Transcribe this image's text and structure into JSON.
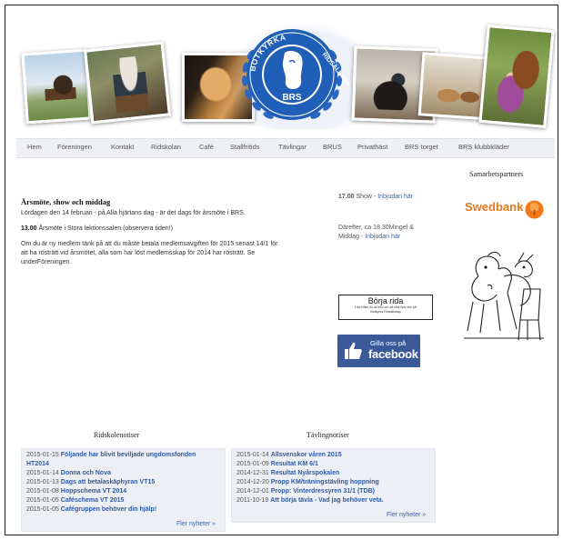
{
  "logo": {
    "ring_top": "BOTKYRKA",
    "ring_right": "RIDSÄLLSKAP",
    "center": "BRS"
  },
  "nav": [
    "Hem",
    "Föreningen",
    "Kontakt",
    "Ridskolan",
    "Café",
    "Stallfritids",
    "Tävlingar",
    "BRUS",
    "Privathäst",
    "BRS torget",
    "BRS klubbkläder"
  ],
  "article": {
    "title": "Årsmöte, show och middag",
    "line1": "Lördagen den 14 februari - på Alla hjärtans dag - är det dags för årsmöte i BRS.",
    "time1": "13.00",
    "line2": " Årsmöte i Stora lektionssalen (observera tiden!)",
    "p3_l1": "Om du är ny medlem tänk på att du måste betala medlemsavgiften för 2015 senast 14/1 för",
    "p3_l2": "att ha rösträtt vid årsmötet, alla som har löst medlemsskap för 2014 har rösträtt. Se",
    "p3_l3": "underFöreningen."
  },
  "side": {
    "time": "17.00",
    "show": " Show - ",
    "show_link": "Inbjudan här",
    "after_l1": "Därefter, ca 18.30Mingel &",
    "after_l2": "Middag - ",
    "after_link": "Inbjudan här"
  },
  "borja": {
    "title": "Börja rida",
    "sub1": "Här hittar du all info om att rida hos oss på",
    "sub2": "Botkyrka Ridsällskap"
  },
  "facebook": {
    "small": "Gilla oss på",
    "big": "facebook"
  },
  "partners": {
    "title": "Samarbetspartners",
    "swedbank": "Swedbank"
  },
  "ridskolan": {
    "title": "Ridskolenotiser",
    "items": [
      {
        "date": "2015-01-15",
        "text": "Följande har blivit beviljade ungdomsfonden"
      },
      {
        "date": "",
        "text": "HT2014"
      },
      {
        "date": "2015-01-14",
        "text": "Donna och Nova"
      },
      {
        "date": "2015-01-13",
        "text": "Dags att betalaskäphyran VT15"
      },
      {
        "date": "2015-01-08",
        "text": "Hoppschema VT 2014"
      },
      {
        "date": "2015-01-05",
        "text": "Caféschema VT 2015"
      },
      {
        "date": "2015-01-05",
        "text": "Cafégruppen behöver din hjälp!"
      }
    ],
    "more": "Fler nyheter »"
  },
  "tavling": {
    "title": "Tävlingnotiser",
    "items": [
      {
        "date": "2015-01-14",
        "text": "Allsvenskor våren 2015"
      },
      {
        "date": "2015-01-09",
        "text": "Resultat KM 6/1"
      },
      {
        "date": "2014-12-31",
        "text": "Resultat Nyårspokalen"
      },
      {
        "date": "2014-12-20",
        "text": "Propp KM/träningstävling hoppning"
      },
      {
        "date": "2014-12-01",
        "text": "Propp: Vinterdressyren 31/1 (TDB)"
      },
      {
        "date": "2011-10-19",
        "text": "Att börja tävla - Vad jag behöver veta."
      }
    ],
    "more": "Fler nyheter »"
  },
  "colors": {
    "link": "#2e5aa8",
    "nav_bg": "#eef0f3",
    "fb": "#3b5998",
    "swedbank": "#e6781e",
    "logo_blue": "#1f5fb8"
  }
}
